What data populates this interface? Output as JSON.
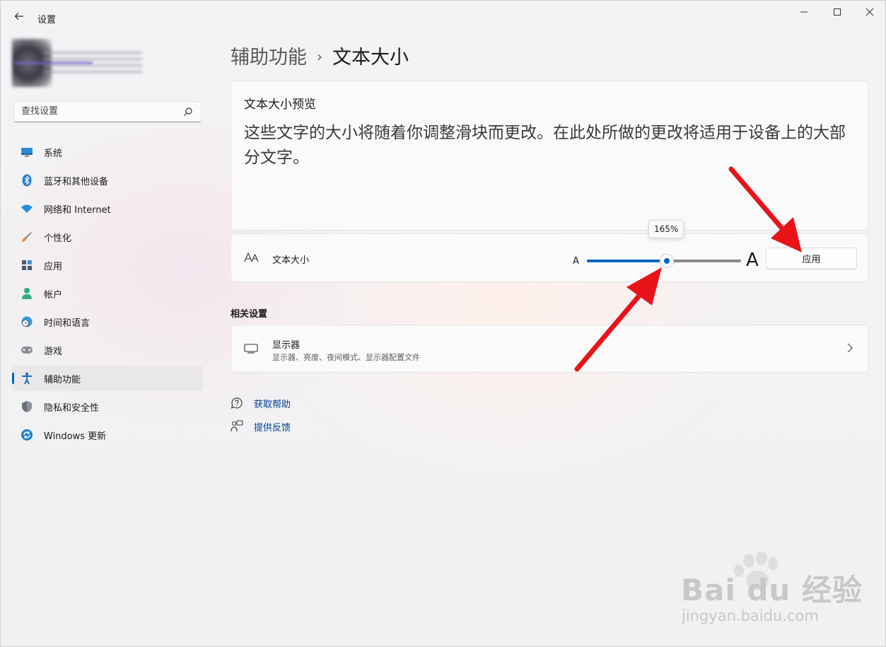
{
  "window": {
    "title": "设置"
  },
  "search": {
    "placeholder": "查找设置"
  },
  "nav": [
    {
      "label": "系统",
      "icon": "monitor-icon"
    },
    {
      "label": "蓝牙和其他设备",
      "icon": "bluetooth-icon"
    },
    {
      "label": "网络和 Internet",
      "icon": "wifi-icon"
    },
    {
      "label": "个性化",
      "icon": "brush-icon"
    },
    {
      "label": "应用",
      "icon": "apps-icon"
    },
    {
      "label": "帐户",
      "icon": "account-icon"
    },
    {
      "label": "时间和语言",
      "icon": "clock-globe-icon"
    },
    {
      "label": "游戏",
      "icon": "gamepad-icon"
    },
    {
      "label": "辅助功能",
      "icon": "accessibility-icon",
      "active": true
    },
    {
      "label": "隐私和安全性",
      "icon": "shield-icon"
    },
    {
      "label": "Windows 更新",
      "icon": "update-icon"
    }
  ],
  "breadcrumb": {
    "parent": "辅助功能",
    "separator": "›",
    "current": "文本大小"
  },
  "preview": {
    "title": "文本大小预览",
    "text": "这些文字的大小将随着你调整滑块而更改。在此处所做的更改将适用于设备上的大部分文字。"
  },
  "text_size": {
    "icon": "text-size-icon",
    "label": "文本大小",
    "small_glyph": "A",
    "large_glyph": "A",
    "value": 165,
    "value_label": "165%",
    "min": 100,
    "max": 225,
    "apply_label": "应用",
    "accent": "#0067c0"
  },
  "related": {
    "title": "相关设置",
    "display": {
      "icon": "display-icon",
      "title": "显示器",
      "subtitle": "显示器、亮度、夜间模式、显示器配置文件"
    }
  },
  "links": [
    {
      "label": "获取帮助",
      "icon": "help-icon"
    },
    {
      "label": "提供反馈",
      "icon": "feedback-icon"
    }
  ],
  "watermark": {
    "text": "Bai du 经验",
    "sub": "jingyan.baidu.com"
  },
  "annotation_color": "#e8141a"
}
